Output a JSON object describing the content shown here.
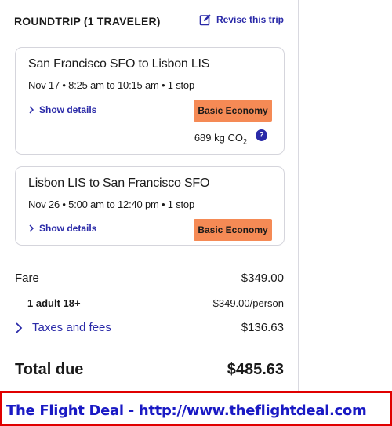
{
  "header": {
    "title": "ROUNDTRIP (1 TRAVELER)",
    "revise_label": "Revise this trip"
  },
  "flights": [
    {
      "route": "San Francisco SFO to Lisbon LIS",
      "times": "Nov 17 • 8:25 am to 10:15 am • 1 stop",
      "details_label": "Show details",
      "fare_class": "Basic Economy",
      "co2": "689 kg CO",
      "co2_sub": "2"
    },
    {
      "route": "Lisbon LIS to San Francisco SFO",
      "times": "Nov 26 • 5:00 am to 12:40 pm • 1 stop",
      "details_label": "Show details",
      "fare_class": "Basic Economy"
    }
  ],
  "pricing": {
    "fare_label": "Fare",
    "fare_value": "$349.00",
    "adult_label": "1 adult 18+",
    "adult_value": "$349.00/person",
    "taxes_label": "Taxes and fees",
    "taxes_value": "$136.63",
    "total_label": "Total due",
    "total_value": "$485.63"
  },
  "banner": {
    "text": "The Flight Deal - http://www.theflightdeal.com"
  },
  "colors": {
    "link": "#2a2aa8",
    "badge": "#f58a55",
    "banner_border": "#e00000",
    "banner_text": "#1a1ac4"
  },
  "icons": [
    "edit-icon",
    "chevron-right-icon",
    "help-icon"
  ]
}
